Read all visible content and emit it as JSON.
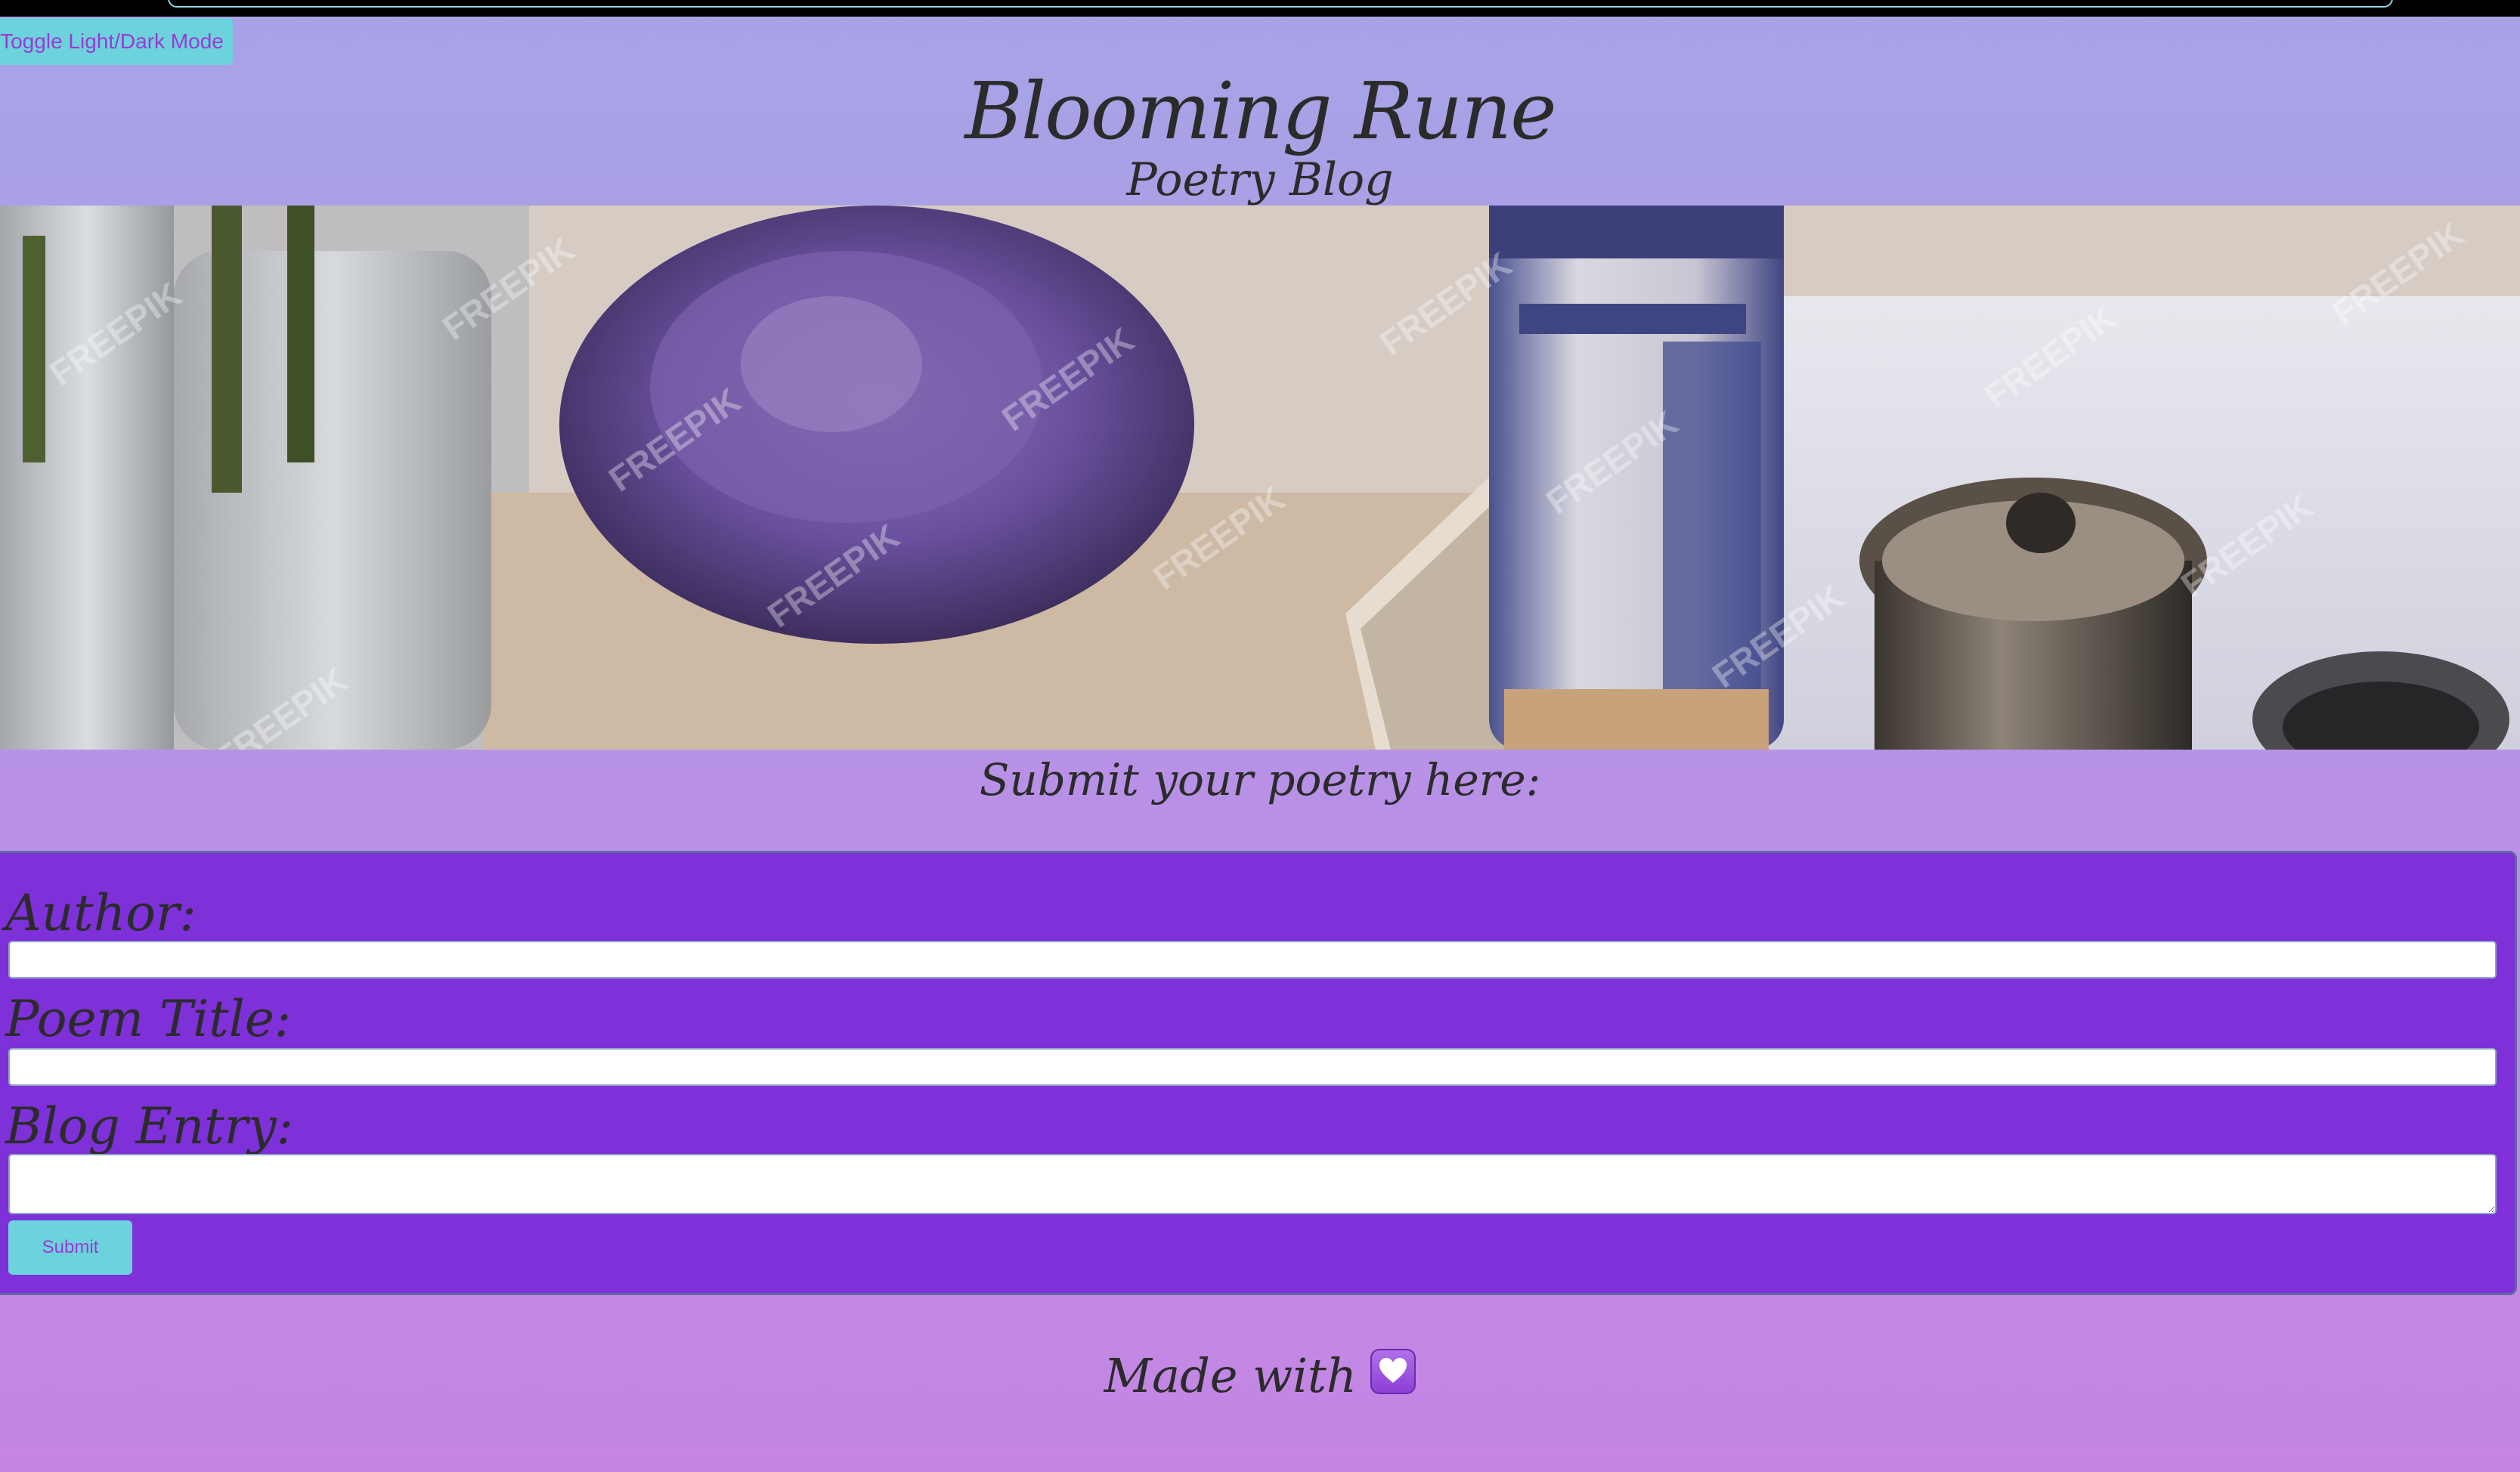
{
  "header": {
    "toggle_label": "Toggle Light/Dark Mode",
    "title": "Blooming Rune",
    "subtitle": "Poetry Blog"
  },
  "hero": {
    "watermark": "FREEPIK"
  },
  "form": {
    "heading": "Submit your poetry here:",
    "author_label": "Author:",
    "author_value": "",
    "title_label": "Poem Title:",
    "title_value": "",
    "entry_label": "Blog Entry:",
    "entry_value": "",
    "submit_label": "Submit"
  },
  "footer": {
    "text": "Made with",
    "icon": "purple-heart-icon"
  },
  "colors": {
    "accent_button_bg": "#6cd2dc",
    "accent_button_text": "#9b3ad6",
    "form_panel_bg": "#7e30d9",
    "page_gradient_top": "#a7a3e6",
    "page_gradient_bottom": "#c585e4"
  }
}
